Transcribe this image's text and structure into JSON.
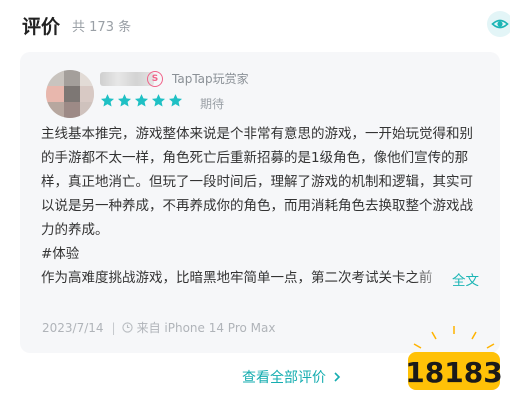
{
  "header": {
    "title": "评价",
    "count": "共 173 条"
  },
  "review": {
    "badge_label": "TapTap玩赏家",
    "rating_stars": 5,
    "rating_label": "期待",
    "paragraphs": [
      "主线基本推完，游戏整体来说是个非常有意思的游戏，一开始玩觉得和别的手游都不太一样，角色死亡后重新招募的是1级角色，像他们宣传的那样，真正地消亡。但玩了一段时间后，理解了游戏的机制和逻辑，其实可以说是另一种养成，不再养成你的角色，而用消耗角色去换取整个游戏战力的养成。",
      "#体验",
      "作为高难度挑战游戏，比暗黑地牢简单一点，第二次考试关卡之前"
    ],
    "full_text_link": "全文",
    "date": "2023/7/14",
    "device": "来自 iPhone 14 Pro Max"
  },
  "footer": {
    "view_all": "查看全部评价"
  },
  "watermark": {
    "text": "18183"
  },
  "colors": {
    "accent": "#16adb0",
    "star": "#1fc0c4",
    "card_bg": "#f6f7f9"
  },
  "icons": [
    "eye-icon",
    "taptap-badge-icon",
    "star-icon",
    "clock-icon",
    "chevron-right-icon"
  ]
}
